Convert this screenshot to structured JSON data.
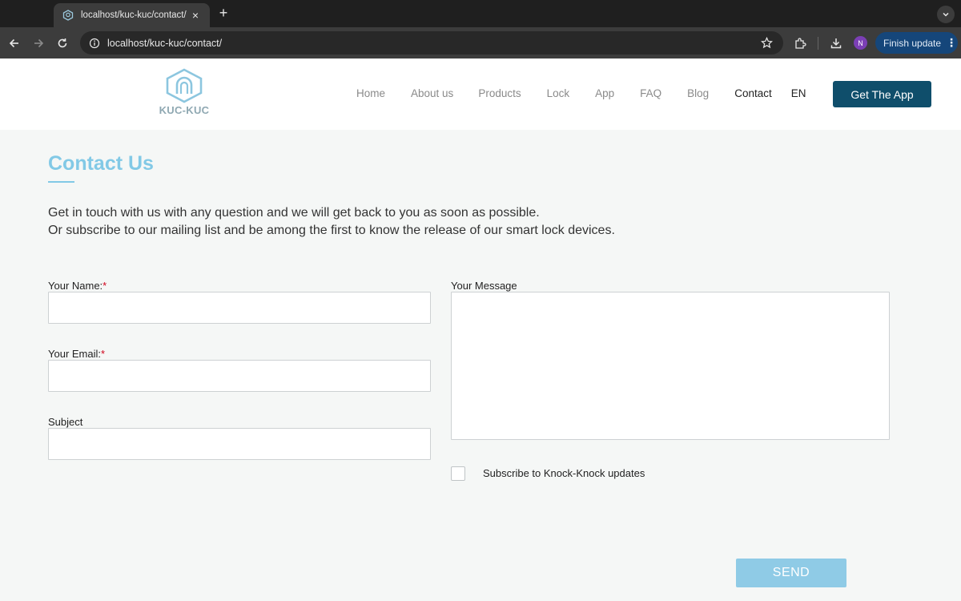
{
  "browser": {
    "tab_title": "localhost/kuc-kuc/contact/",
    "close_glyph": "×",
    "new_tab_glyph": "+",
    "url": "localhost/kuc-kuc/contact/",
    "profile_initial": "N",
    "update_label": "Finish update",
    "update_menu_glyph": "⋮"
  },
  "site": {
    "logo_text": "KUC-KUC",
    "nav": {
      "home": "Home",
      "about": "About us",
      "products": "Products",
      "lock": "Lock",
      "app": "App",
      "faq": "FAQ",
      "blog": "Blog",
      "contact": "Contact",
      "lang": "EN"
    },
    "active_nav": "Contact",
    "cta": "Get The App"
  },
  "contact": {
    "title": "Contact Us",
    "intro_line1": "Get in touch with us with any question and we will get back to you as soon as possible.",
    "intro_line2": "Or subscribe to our mailing list and be among the first to know the release of our smart lock devices.",
    "name_label": "Your Name:",
    "email_label": "Your Email:",
    "required_mark": "*",
    "subject_label": "Subject",
    "message_label": "Your Message",
    "name_value": "",
    "email_value": "",
    "subject_value": "",
    "message_value": "",
    "subscribe_label": "Subscribe to Knock-Knock updates",
    "subscribe_checked": false,
    "send_label": "SEND"
  },
  "colors": {
    "accent": "#82c9e6",
    "cta_bg": "#0f4e6b",
    "required": "#d0021b",
    "page_bg": "#f5f7f6"
  },
  "icons": {
    "tab_favicon": "kuc-kuc-logo-icon",
    "back": "arrow-left-icon",
    "forward": "arrow-right-icon",
    "reload": "reload-icon",
    "site_info": "info-icon",
    "bookmark": "star-icon",
    "extensions": "puzzle-icon",
    "downloads": "download-icon",
    "tab_menu": "chevron-down-icon"
  }
}
